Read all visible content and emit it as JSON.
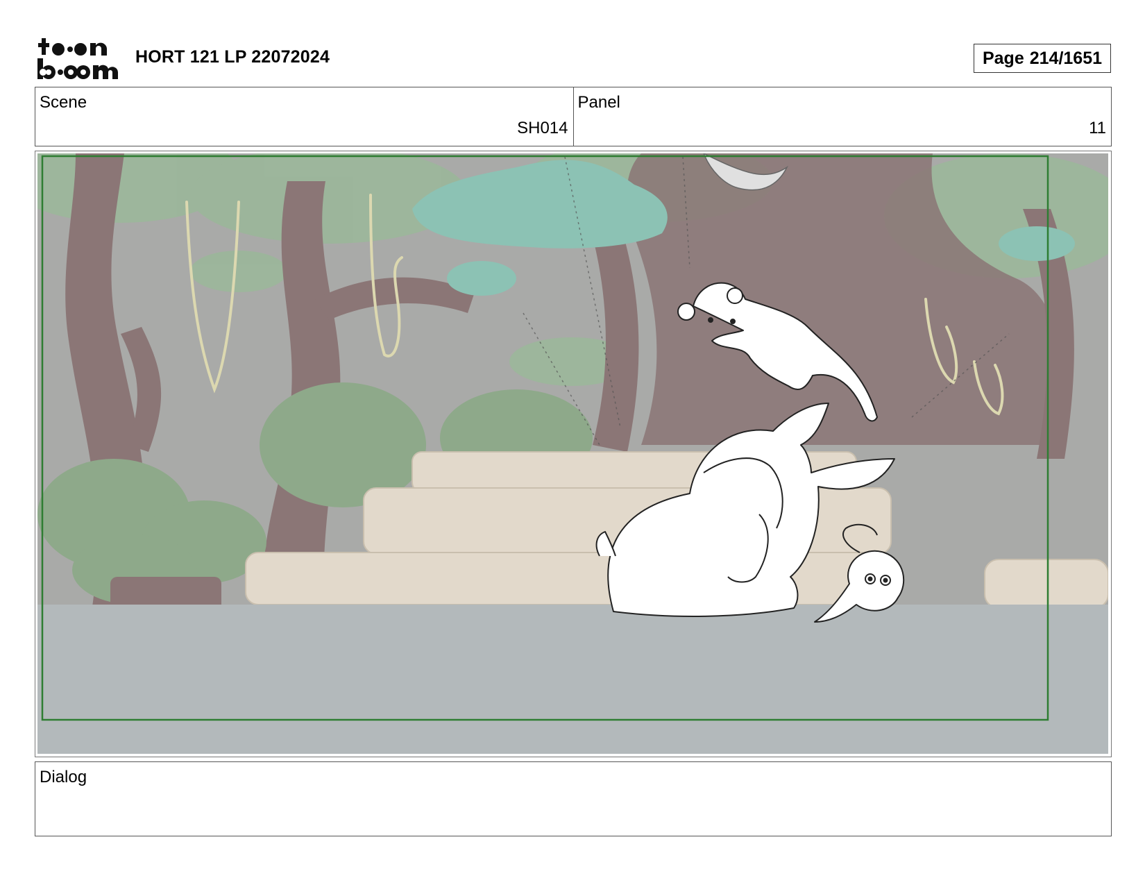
{
  "header": {
    "logo_text": "toon boom",
    "title": "HORT 121 LP 22072024",
    "page_label": "Page",
    "page_value": "214/1651"
  },
  "scene": {
    "label": "Scene",
    "value": "SH014"
  },
  "panel": {
    "label": "Panel",
    "value": "11"
  },
  "dialog": {
    "label": "Dialog",
    "text": ""
  },
  "colors": {
    "safe_frame": "#2e7d32",
    "foliage": "#8fb08c",
    "trunks": "#8a7474",
    "sky_fog": "#a8a8a8",
    "ground": "#b2b8ba",
    "steps": "#e2d9cb"
  }
}
